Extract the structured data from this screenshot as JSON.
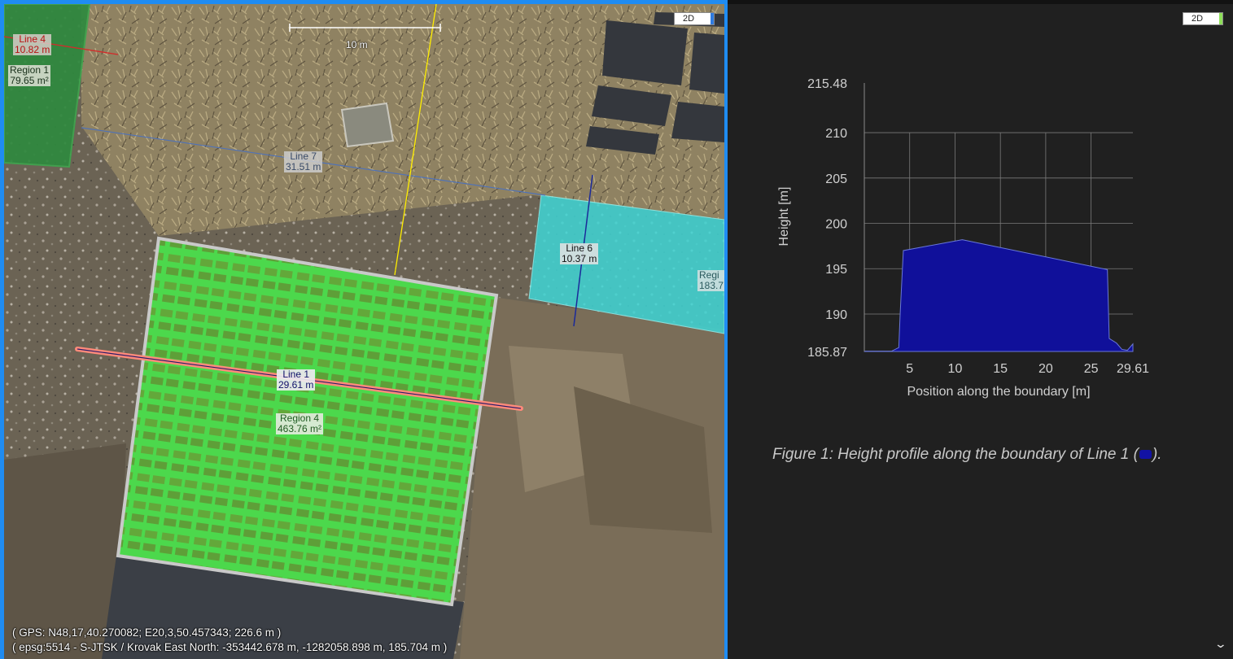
{
  "map": {
    "view_mode": "2D",
    "scale_bar_label": "10 m",
    "coords": {
      "gps": "( GPS: N48,17,40.270082; E20,3,50.457343; 226.6 m )",
      "epsg": "( epsg:5514 - S-JTSK / Krovak East North: -353442.678 m, -1282058.898 m, 185.704 m )"
    },
    "annotations": {
      "line4": {
        "name": "Line 4",
        "value": "10.82 m",
        "color": "#d42a2a"
      },
      "region1": {
        "name": "Region 1",
        "value": "79.65 m²",
        "color": "#2e8b3e"
      },
      "line7": {
        "name": "Line 7",
        "value": "31.51 m",
        "color": "#4f72b8"
      },
      "line6": {
        "name": "Line 6",
        "value": "10.37 m",
        "color": "#1b2a9a"
      },
      "line1": {
        "name": "Line 1",
        "value": "29.61 m",
        "color": "#ff8a7a"
      },
      "region4": {
        "name": "Region 4",
        "value": "463.76 m²",
        "color": "#5cf05c"
      },
      "region_right": {
        "name": "Regi",
        "value": "183.7",
        "color": "#3fd6d6"
      }
    }
  },
  "chart_panel": {
    "view_mode": "2D",
    "caption_prefix": "Figure 1: Height profile along the boundary of Line 1 (",
    "caption_suffix": ")."
  },
  "chart_data": {
    "type": "area",
    "xlabel": "Position along the boundary [m]",
    "ylabel": "Height [m]",
    "xlim": [
      0,
      29.61
    ],
    "ylim": [
      185.87,
      215.48
    ],
    "x_ticks": [
      "5",
      "10",
      "15",
      "20",
      "25",
      "29.61"
    ],
    "y_ticks": [
      "215.48",
      "210",
      "205",
      "200",
      "195",
      "190",
      "185.87"
    ],
    "grid": true,
    "series": [
      {
        "color": "#10109a",
        "x": [
          0,
          3.0,
          3.8,
          3.95,
          4.3,
          10.8,
          26.8,
          27.0,
          27.8,
          28.4,
          29.0,
          29.61
        ],
        "y": [
          185.9,
          185.9,
          186.3,
          190.0,
          197.0,
          198.2,
          194.9,
          187.3,
          186.8,
          186.1,
          186.0,
          186.7
        ]
      }
    ]
  }
}
